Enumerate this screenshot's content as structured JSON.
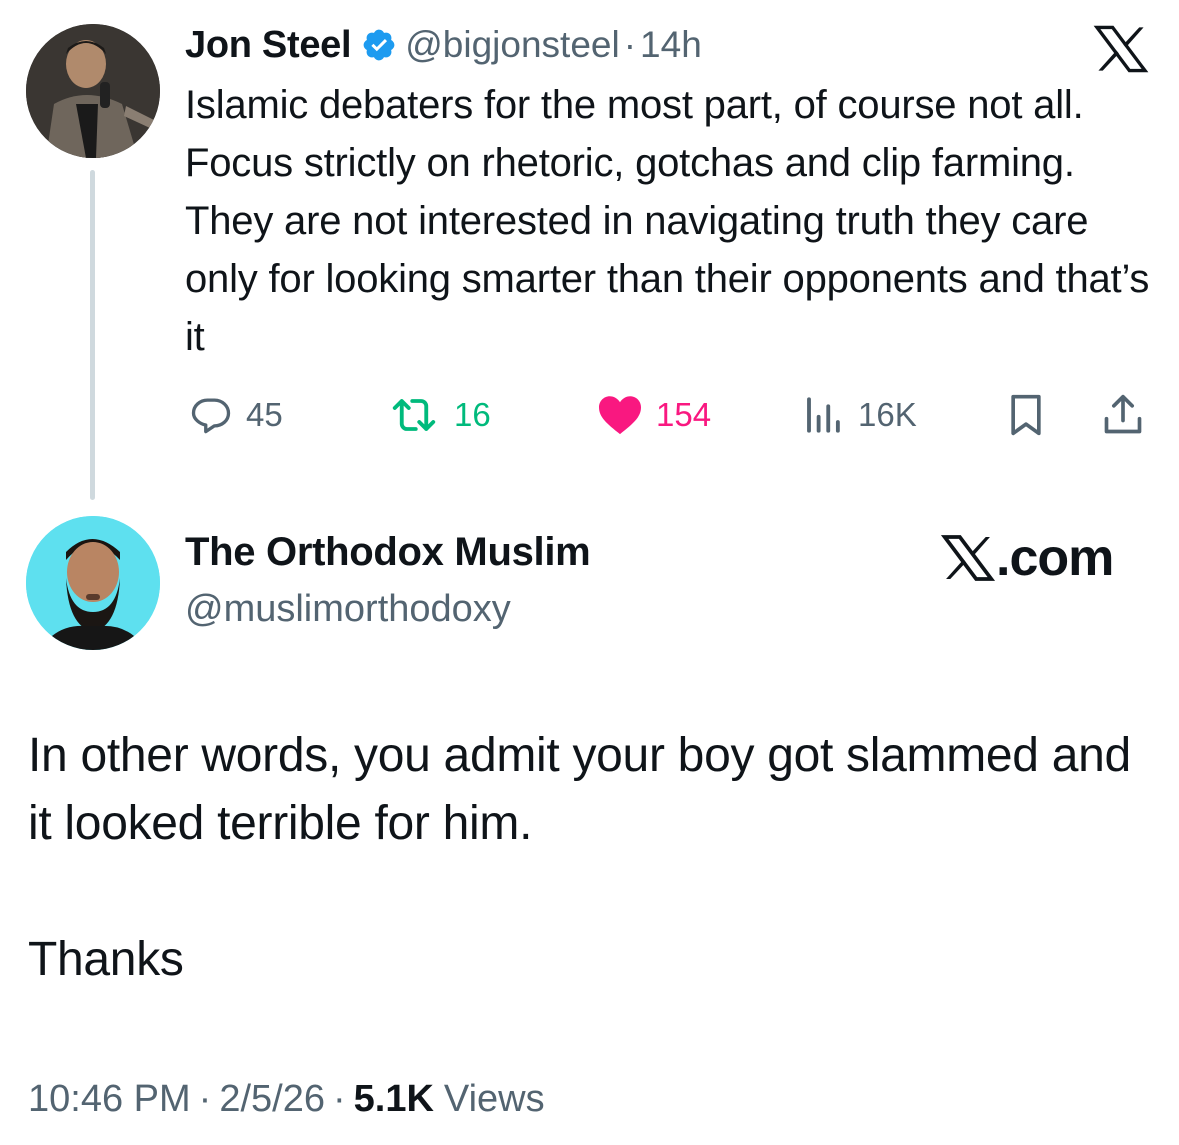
{
  "thread": {
    "parent": {
      "author_name": "Jon Steel",
      "handle": "@bigjonsteel",
      "separator": "·",
      "time": "14h",
      "text": "Islamic debaters for the most part, of course not all. Focus strictly on rhetoric, gotchas and clip farming. They are not interested in navigating truth they care only for looking smarter than their opponents and that’s it",
      "replies": "45",
      "reposts": "16",
      "likes": "154",
      "views": "16K"
    },
    "reply": {
      "author_name": "The Orthodox Muslim",
      "handle": "@muslimorthodoxy",
      "brand_text": ".com",
      "text": "In other words, you admit your boy got slammed and it looked terrible for him.\n\nThanks",
      "time": "10:46 PM",
      "separator": "·",
      "date": "2/5/26",
      "views_count": "5.1K",
      "views_label": "Views"
    }
  },
  "colors": {
    "text": "#0f1419",
    "muted": "#536471",
    "verified": "#1d9bf0",
    "repost": "#00ba7c",
    "like": "#f91880",
    "avatar_reply_bg": "#5ee0ef"
  },
  "icons": [
    "verified-badge-icon",
    "x-logo-icon",
    "reply-icon",
    "repost-icon",
    "like-icon",
    "views-icon",
    "bookmark-icon",
    "share-icon"
  ]
}
